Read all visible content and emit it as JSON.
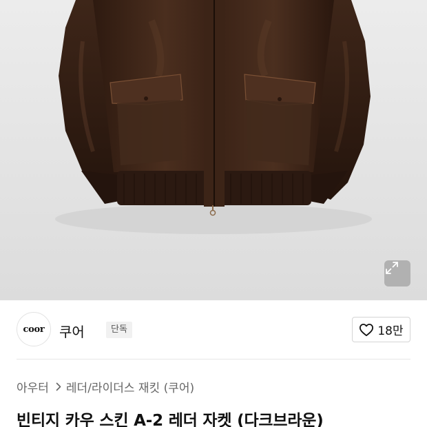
{
  "hero": {
    "icons": {
      "expand": "expand-arrows-icon"
    },
    "colors": {
      "background": "#e4e4e4",
      "leather": "#3a2418",
      "rib": "#2b1a12"
    }
  },
  "brand": {
    "logo_text": "coor",
    "name": "쿠어",
    "badge": "단독"
  },
  "like": {
    "icon": "heart-outline-icon",
    "count": "18만"
  },
  "breadcrumb": {
    "category": "아우터",
    "subcategory": "레더/라이더스 재킷 (쿠어)",
    "separator_icon": "chevron-right-icon"
  },
  "product": {
    "title": "빈티지 카우 스킨 A-2 레더 자켓 (다크브라운)"
  }
}
